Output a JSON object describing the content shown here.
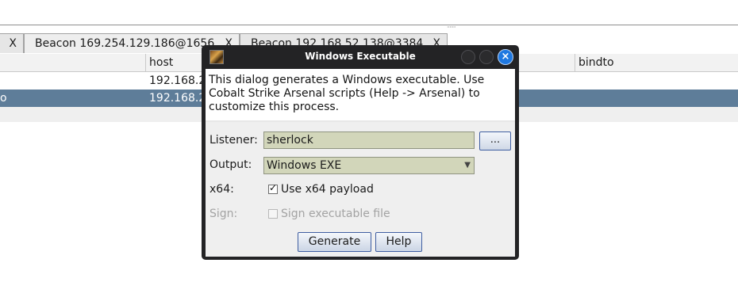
{
  "tabs": [
    {
      "label": "",
      "close": "X"
    },
    {
      "label": "Beacon 169.254.129.186@1656",
      "close": "X"
    },
    {
      "label": "Beacon 192.168.52.138@3384",
      "close": "X"
    }
  ],
  "table": {
    "columns": [
      "host",
      "bindto"
    ],
    "rows": [
      {
        "lead": "",
        "host": "192.168.2"
      },
      {
        "lead": "o",
        "host": "192.168.2"
      }
    ]
  },
  "dialog": {
    "title": "Windows Executable",
    "close_glyph": "×",
    "description": "This dialog generates a Windows executable. Use Cobalt Strike Arsenal scripts (Help -> Arsenal) to customize this process.",
    "listener": {
      "label": "Listener:",
      "value": "sherlock",
      "browse_label": "..."
    },
    "output": {
      "label": "Output:",
      "value": "Windows EXE"
    },
    "x64": {
      "label": "x64:",
      "checkbox_label": "Use x64 payload",
      "checked": true
    },
    "sign": {
      "label": "Sign:",
      "checkbox_label": "Sign executable file",
      "checked": false,
      "enabled": false
    },
    "buttons": {
      "generate": "Generate",
      "help": "Help"
    }
  },
  "colors": {
    "selected_row": "#5e7d99",
    "field_bg": "#d2d6ba",
    "titlebar": "#232325",
    "close_button": "#1f78e0"
  },
  "icons": {
    "app": "cobalt-strike-app-icon",
    "dropdown": "chevron-down-icon",
    "close": "close-icon"
  }
}
